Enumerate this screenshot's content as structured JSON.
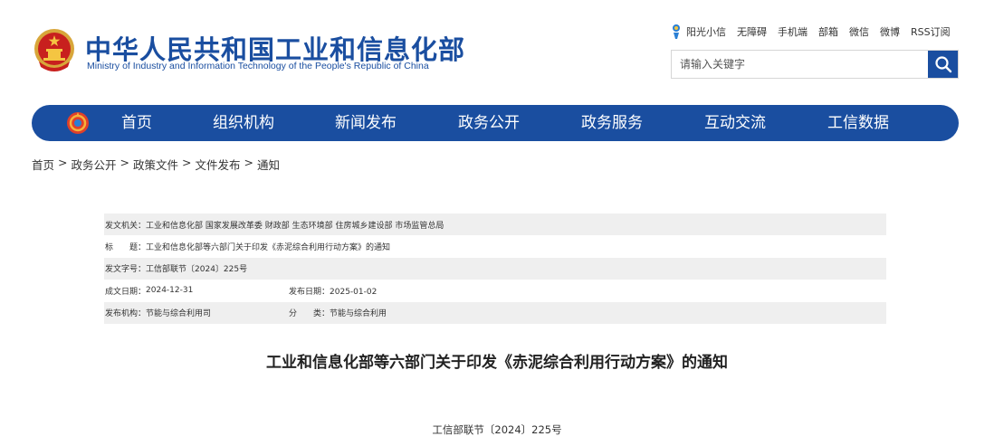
{
  "header": {
    "title": "中华人民共和国工业和信息化部",
    "subtitle": "Ministry of Industry and Information Technology of the People's Republic of China",
    "emblem_icon": "national-emblem-icon",
    "brand_color": "#1a4ea0"
  },
  "toplinks": {
    "sunshine": "阳光小信",
    "accessibility": "无障碍",
    "mobile": "手机端",
    "mailbox": "部箱",
    "wechat": "微信",
    "weibo": "微博",
    "rss": "RSS订阅"
  },
  "search": {
    "placeholder": "请输入关键字",
    "button_icon": "search-icon"
  },
  "nav": {
    "logo_icon": "miit-logo-icon",
    "items": [
      "首页",
      "组织机构",
      "新闻发布",
      "政务公开",
      "政务服务",
      "互动交流",
      "工信数据"
    ]
  },
  "breadcrumb": {
    "items": [
      "首页",
      "政务公开",
      "政策文件",
      "文件发布",
      "通知"
    ],
    "separator": ">"
  },
  "info": {
    "issuer_label": "发文机关：",
    "issuer": "工业和信息化部 国家发展改革委 财政部 生态环境部 住房城乡建设部 市场监管总局",
    "title_label": "标　　题：",
    "title": "工业和信息化部等六部门关于印发《赤泥综合利用行动方案》的通知",
    "docno_label": "发文字号：",
    "docno": "工信部联节〔2024〕225号",
    "created_label": "成文日期：",
    "created": "2024-12-31",
    "published_label": "发布日期：",
    "published": "2025-01-02",
    "org_label": "发布机构：",
    "org": "节能与综合利用司",
    "category_label": "分　　类：",
    "category": "节能与综合利用"
  },
  "article": {
    "title": "工业和信息化部等六部门关于印发《赤泥综合利用行动方案》的通知",
    "doc_number": "工信部联节〔2024〕225号"
  }
}
